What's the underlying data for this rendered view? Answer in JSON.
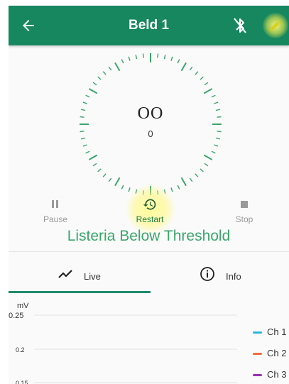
{
  "header": {
    "title": "Beld 1",
    "bg_color": "#16875f",
    "icons": [
      "back-arrow-icon",
      "bluetooth-disabled-icon",
      "pencil-icon"
    ]
  },
  "dial": {
    "value": "OO",
    "subvalue": "0",
    "tick_color": "#3aa66b"
  },
  "controls": {
    "pause_label": "Pause",
    "restart_label": "Restart",
    "stop_label": "Stop"
  },
  "status": {
    "text": "Listeria Below Threshold",
    "color": "#3aa66b"
  },
  "tabs": [
    {
      "label": "Live",
      "icon": "trend-line-icon",
      "active": true
    },
    {
      "label": "Info",
      "icon": "info-circle-icon",
      "active": false
    }
  ],
  "chart_data": {
    "type": "line",
    "ylabel": "mV",
    "y_ticks": [
      "0.25",
      "0.2",
      "0.15"
    ],
    "grid": true,
    "legend_position": "right",
    "series": [
      {
        "name": "Ch 1",
        "color": "#29b6e0",
        "values": []
      },
      {
        "name": "Ch 2",
        "color": "#f26b3a",
        "values": []
      },
      {
        "name": "Ch 3",
        "color": "#9b2fb5",
        "values": []
      }
    ]
  }
}
